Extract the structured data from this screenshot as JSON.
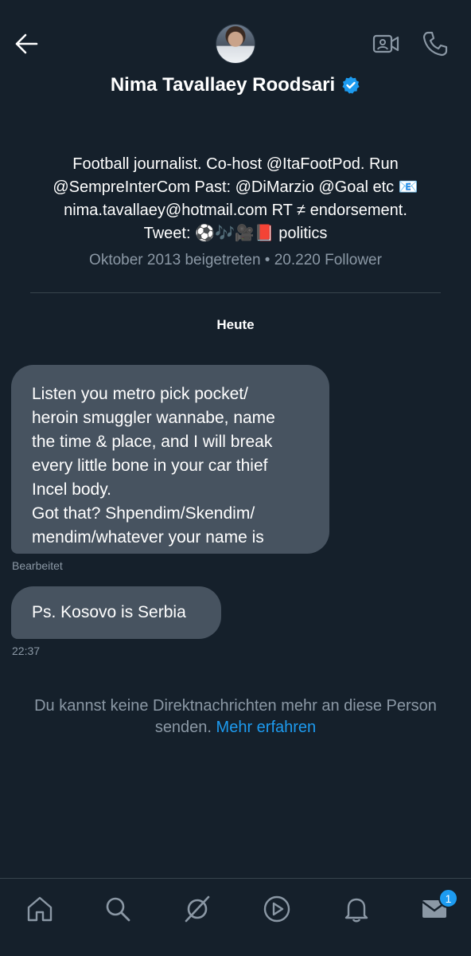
{
  "header": {
    "name": "Nima Tavallaey Roodsari",
    "verified": true,
    "icons": {
      "back": "arrow-left-icon",
      "video": "video-call-icon",
      "call": "phone-icon",
      "verified": "verified-badge-icon"
    }
  },
  "profile": {
    "bio_lines": [
      "Football journalist. Co-host @ItaFootPod. Run",
      "@SempreInterCom Past: @DiMarzio @Goal etc 📧",
      "nima.tavallaey@hotmail.com RT ≠ endorsement.",
      "Tweet: ⚽🎶🎥📕 politics"
    ],
    "meta": "Oktober 2013 beigetreten • 20.220 Follower"
  },
  "conversation": {
    "day_label": "Heute",
    "messages": [
      {
        "lines": [
          "Listen you metro pick pocket/",
          "heroin smuggler wannabe, name",
          "the time & place, and I will break",
          "every little bone in your car thief",
          "Incel body.",
          "Got that? Shpendim/Skendim/",
          "mendim/whatever your name is"
        ],
        "status": "Bearbeitet"
      },
      {
        "text": "Ps. Kosovo is Serbia",
        "time": "22:37"
      }
    ],
    "notice": {
      "text": "Du kannst keine Direktnachrichten mehr an diese Person senden.",
      "link": "Mehr erfahren"
    }
  },
  "bottom_nav": {
    "items": [
      "home-icon",
      "search-icon",
      "grok-icon",
      "video-icon",
      "notifications-icon",
      "messages-icon"
    ],
    "messages_badge": "1"
  },
  "colors": {
    "background": "#15202b",
    "bubble": "#475360",
    "muted_text": "#8b98a5",
    "accent": "#1d9bf0",
    "divider": "#38444d"
  }
}
